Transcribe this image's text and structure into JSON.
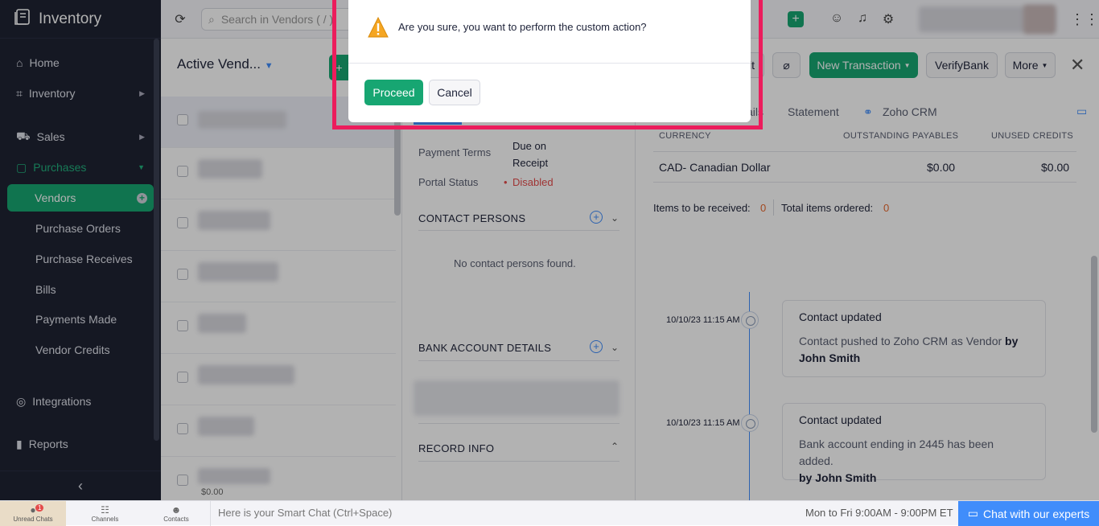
{
  "app": {
    "title": "Inventory"
  },
  "sidebar": {
    "items": [
      {
        "label": "Home"
      },
      {
        "label": "Inventory"
      },
      {
        "label": "Sales"
      },
      {
        "label": "Purchases"
      },
      {
        "label": "Vendors"
      },
      {
        "label": "Purchase Orders"
      },
      {
        "label": "Purchase Receives"
      },
      {
        "label": "Bills"
      },
      {
        "label": "Payments Made"
      },
      {
        "label": "Vendor Credits"
      },
      {
        "label": "Integrations"
      },
      {
        "label": "Reports"
      }
    ]
  },
  "topbar": {
    "search_placeholder": "Search in Vendors ( / )"
  },
  "list": {
    "title": "Active Vend...",
    "partial_amount": "$0.00"
  },
  "details": {
    "payment_terms_label": "Payment Terms",
    "payment_terms_value": "Due on Receipt",
    "portal_status_label": "Portal Status",
    "portal_status_value": "Disabled",
    "contact_persons_heading": "CONTACT PERSONS",
    "no_contacts": "No contact persons found.",
    "bank_heading": "BANK ACCOUNT DETAILS",
    "record_info_heading": "RECORD INFO"
  },
  "toolbar": {
    "edit_label": "it",
    "new_transaction_label": "New Transaction",
    "verify_bank_label": "VerifyBank",
    "more_label": "More"
  },
  "tabs": {
    "partial": "ails",
    "statement": "Statement",
    "zoho_crm": "Zoho CRM"
  },
  "table": {
    "headers": [
      "CURRENCY",
      "OUTSTANDING PAYABLES",
      "UNUSED CREDITS"
    ],
    "row": [
      "CAD- Canadian Dollar",
      "$0.00",
      "$0.00"
    ]
  },
  "items": {
    "received_label": "Items to be received:",
    "received_value": "0",
    "ordered_label": "Total items ordered:",
    "ordered_value": "0"
  },
  "timeline": [
    {
      "time": "10/10/23 11:15 AM",
      "title": "Contact updated",
      "desc": "Contact pushed to Zoho CRM as Vendor",
      "by": "by John Smith"
    },
    {
      "time": "10/10/23 11:15 AM",
      "title": "Contact updated",
      "desc": "Bank account ending in 2445 has been added.",
      "by": "by John Smith"
    }
  ],
  "footer": {
    "unread_chats": "Unread Chats",
    "unread_count": "1",
    "channels": "Channels",
    "contacts": "Contacts",
    "smart_chat_placeholder": "Here is your Smart Chat (Ctrl+Space)",
    "hours": "Mon to Fri 9:00AM - 9:00PM ET",
    "chat_experts": "Chat with our experts"
  },
  "modal": {
    "message": "Are you sure, you want to perform the custom action?",
    "proceed_label": "Proceed",
    "cancel_label": "Cancel"
  },
  "colors": {
    "accent": "#17a672",
    "sidebar_bg": "#1f2333",
    "link_blue": "#408dfb",
    "highlight": "#ec1c5c",
    "danger": "#e44b4b"
  }
}
